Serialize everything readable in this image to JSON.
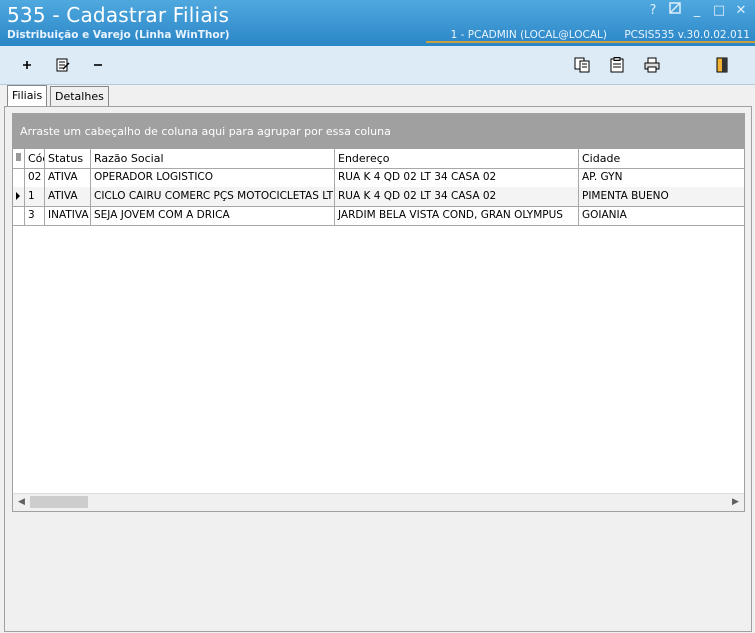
{
  "window": {
    "title": "535 - Cadastrar Filiais",
    "subtitle": "Distribuição e Varejo (Linha WinThor)",
    "session": "1 - PCADMIN (LOCAL@LOCAL)",
    "program_version": "PCSIS535  v.30.0.02.011",
    "help_glyph": "?",
    "minimize_glyph": "_",
    "maximize_glyph": "□",
    "close_glyph": "✕"
  },
  "toolbar": {
    "add_icon": "plus-icon",
    "edit_icon": "edit-document-icon",
    "remove_icon": "minus-icon",
    "copy_icon": "copy-icon",
    "clipboard_icon": "clipboard-icon",
    "print_icon": "printer-icon",
    "exit_icon": "exit-door-icon"
  },
  "tabs": [
    {
      "label": "Filiais",
      "active": true
    },
    {
      "label": "Detalhes",
      "active": false
    }
  ],
  "grid": {
    "group_hint": "Arraste um cabeçalho de coluna aqui para agrupar por essa coluna",
    "columns": [
      "Cód",
      "Status",
      "Razão Social",
      "Endereço",
      "Cidade"
    ],
    "rows": [
      {
        "code": "02",
        "status": "ATIVA",
        "razao": "OPERADOR LOGISTICO",
        "endereco": "RUA K 4 QD 02 LT 34 CASA 02",
        "cidade": "AP. GYN",
        "selected": false
      },
      {
        "code": "1",
        "status": "ATIVA",
        "razao": "CICLO CAIRU COMERC PÇS MOTOCICLETAS LTDA",
        "endereco": "RUA K 4 QD 02 LT 34 CASA 02",
        "cidade": "PIMENTA BUENO",
        "selected": true
      },
      {
        "code": "3",
        "status": "INATIVA",
        "razao": "SEJA JOVEM COM A DRICA",
        "endereco": "JARDIM BELA VISTA COND, GRAN OLYMPUS",
        "cidade": "GOIANIA",
        "selected": false
      }
    ]
  },
  "colors": {
    "titlebar": "#2b86c7",
    "toolbar": "#dcebf6",
    "groupbar": "#a0a0a0",
    "accent": "#c9a040"
  }
}
